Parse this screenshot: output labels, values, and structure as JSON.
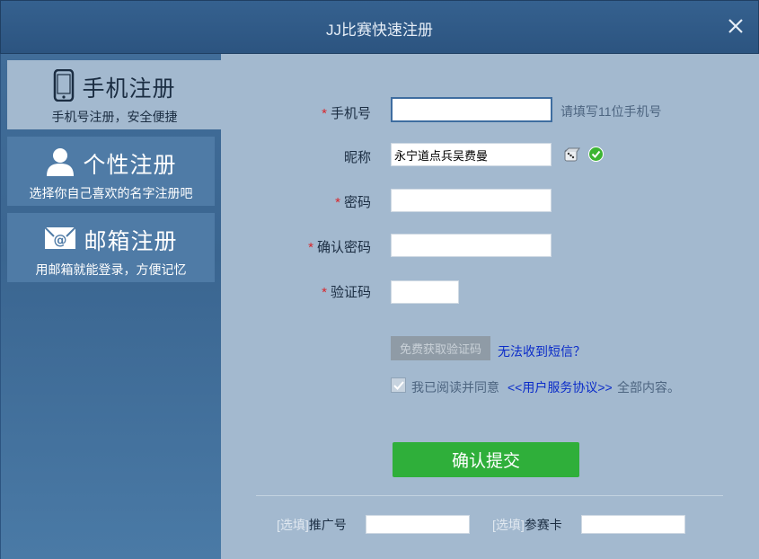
{
  "window": {
    "title": "JJ比赛快速注册"
  },
  "sidebar": {
    "items": [
      {
        "label": "手机注册",
        "sub": "手机号注册，安全便捷",
        "icon": "phone-icon",
        "active": true
      },
      {
        "label": "个性注册",
        "sub": "选择你自己喜欢的名字注册吧",
        "icon": "user-icon",
        "active": false
      },
      {
        "label": "邮箱注册",
        "sub": "用邮箱就能登录，方便记忆",
        "icon": "email-icon",
        "active": false
      }
    ]
  },
  "form": {
    "required_mark": "*",
    "phone": {
      "label": "手机号",
      "value": "",
      "hint": "请填写11位手机号"
    },
    "nickname": {
      "label": "昵称",
      "value": "永宁道点兵吴费曼"
    },
    "password": {
      "label": "密码",
      "value": ""
    },
    "confirm_password": {
      "label": "确认密码",
      "value": ""
    },
    "captcha": {
      "label": "验证码",
      "value": ""
    },
    "get_code_button": "免费获取验证码",
    "no_sms_link": "无法收到短信？",
    "agree": {
      "checked": true,
      "prefix": "我已阅读并同意",
      "link": "<<用户服务协议>>",
      "suffix": "全部内容。"
    },
    "submit": "确认提交"
  },
  "optional": {
    "tag": "[选填]",
    "referrer": {
      "label": "推广号",
      "value": ""
    },
    "card": {
      "label": "参赛卡",
      "value": ""
    }
  },
  "colors": {
    "accent": "#2faf3a",
    "title_bar": "#2f5a87",
    "link": "#0b2cc9",
    "required": "#d8262c"
  }
}
